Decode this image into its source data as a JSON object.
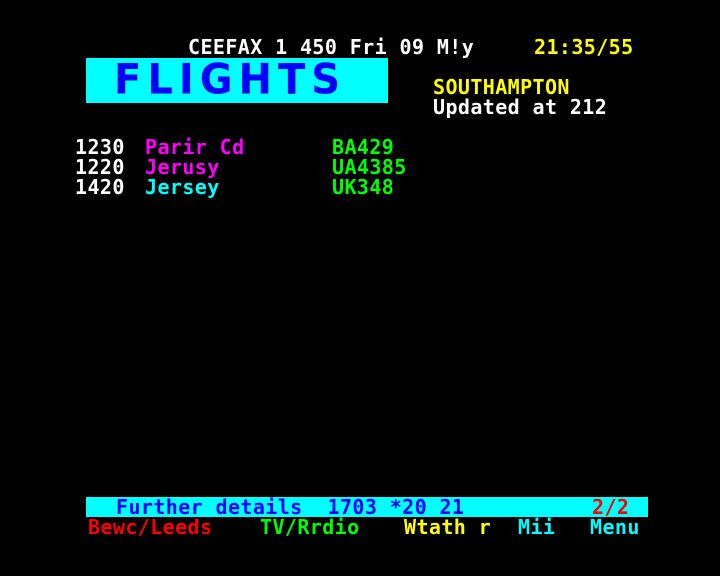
{
  "header": {
    "service_line": "CEEFAX 1 450 Fri 09 M!y",
    "clock": "21:35/55"
  },
  "logo": {
    "text": "FLIGHTS",
    "background": "#00ffff",
    "foreground": "#0000ff"
  },
  "info": {
    "location": "SOUTHAMPTON",
    "updated": "Updated at 212"
  },
  "flights": [
    {
      "time": "1230",
      "destination": "Parir Cd",
      "flight": "BA429",
      "destination_color": "#ff00ff"
    },
    {
      "time": "1220",
      "destination": "Jerusy",
      "flight": "UA4385",
      "destination_color": "#ff00ff"
    },
    {
      "time": "1420",
      "destination": "Jersey",
      "flight": "UK348",
      "destination_color": "#00ffff"
    }
  ],
  "footer": {
    "further_details": "Further details  1703 *20 21",
    "page_indicator": "2/2",
    "fastext": {
      "red": "Bewc/Leeds",
      "green": "TV/Rrdio",
      "yellow": "Wtath r",
      "cyan_a": "Mii",
      "cyan_b": "Menu"
    }
  },
  "colors": {
    "background": "#000000",
    "white": "#ffffff",
    "yellow": "#ffff00",
    "magenta": "#ff00ff",
    "cyan": "#00ffff",
    "green": "#00ff00",
    "red": "#ff0000",
    "blue": "#0000ff"
  }
}
